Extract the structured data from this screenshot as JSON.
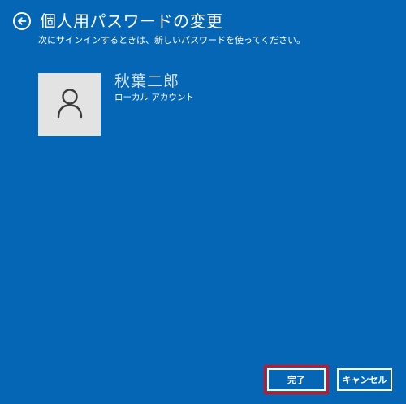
{
  "header": {
    "title": "個人用パスワードの変更"
  },
  "instruction": "次にサインインするときは、新しいパスワードを使ってください。",
  "account": {
    "name": "秋葉二郎",
    "type": "ローカル アカウント"
  },
  "buttons": {
    "finish_label": "完了",
    "cancel_label": "キャンセル"
  },
  "colors": {
    "background": "#0566b5",
    "avatar_background": "#e3e3e3",
    "highlight": "#d4121d",
    "text": "#ffffff"
  },
  "icons": {
    "back": "back-arrow-icon",
    "user": "user-icon"
  }
}
